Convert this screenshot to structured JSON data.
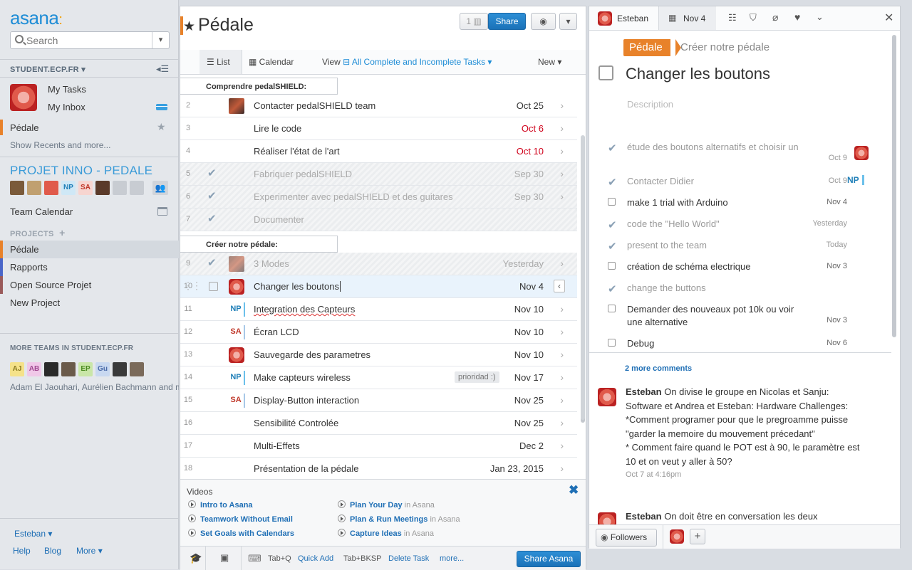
{
  "sidebar": {
    "logo": "asana",
    "search_placeholder": "Search",
    "workspace": "STUDENT.ECP.FR",
    "my_tasks": "My Tasks",
    "my_inbox": "My Inbox",
    "favorite": "Pédale",
    "show_recents": "Show Recents and more...",
    "team_name": "PROJET INNO - PEDALE",
    "team_members": [
      {
        "initials": "",
        "color": "#7a5a3a"
      },
      {
        "initials": "",
        "color": "#c0a070"
      },
      {
        "initials": "",
        "color": "#e05a4b"
      },
      {
        "initials": "NP",
        "color": "#cfe8f6",
        "text": "#1f7fb8"
      },
      {
        "initials": "SA",
        "color": "#f7d5d0",
        "text": "#c0392b"
      },
      {
        "initials": "",
        "color": "#5a3a2a"
      },
      {
        "initials": "",
        "color": "#c8ccd2"
      },
      {
        "initials": "",
        "color": "#c8ccd2"
      }
    ],
    "team_calendar": "Team Calendar",
    "projects_header": "PROJECTS",
    "projects": [
      {
        "name": "Pédale",
        "color": "#e8822a"
      },
      {
        "name": "Rapports",
        "color": "#4a66c9"
      },
      {
        "name": "Open Source Projet",
        "color": "#9a5a5a"
      },
      {
        "name": "New Project",
        "color": ""
      }
    ],
    "more_teams_header": "MORE TEAMS IN STUDENT.ECP.FR",
    "more_team_members": [
      {
        "initials": "AJ",
        "color": "#f5e28a",
        "text": "#8a7a20"
      },
      {
        "initials": "AB",
        "color": "#f0c8e8",
        "text": "#a04890"
      },
      {
        "initials": "",
        "color": "#2a2a2a"
      },
      {
        "initials": "",
        "color": "#6a5a4a"
      },
      {
        "initials": "EP",
        "color": "#c9e6a8",
        "text": "#4a8a20"
      },
      {
        "initials": "Gu",
        "color": "#c8d8f0",
        "text": "#4a6aa8"
      },
      {
        "initials": "",
        "color": "#3a3a3a"
      },
      {
        "initials": "",
        "color": "#7a6a5a"
      }
    ],
    "more_teams_names": "Adam El Jaouhari, Aurélien Bachmann and m",
    "user": "Esteban",
    "help": "Help",
    "blog": "Blog",
    "more": "More"
  },
  "project": {
    "title": "Pédale",
    "member_count": "1",
    "share": "Share",
    "tab_list": "List",
    "tab_calendar": "Calendar",
    "view_label": "View",
    "view_value": "All Complete and Incomplete Tasks",
    "new_label": "New"
  },
  "sections": [
    {
      "title": "Comprendre pedalSHIELD:"
    },
    {
      "title": "Créer notre pédale:"
    }
  ],
  "tasks": [
    {
      "num": "2",
      "name": "Contacter pedalSHIELD team",
      "due": "Oct 25",
      "assignee": "photo",
      "done": false
    },
    {
      "num": "3",
      "name": "Lire le code",
      "due": "Oct 6",
      "overdue": true,
      "done": false
    },
    {
      "num": "4",
      "name": "Réaliser l'état de l'art",
      "due": "Oct 10",
      "overdue": true,
      "done": false
    },
    {
      "num": "5",
      "name": "Fabriquer pedalSHIELD",
      "due": "Sep 30",
      "done": true
    },
    {
      "num": "6",
      "name": "Experimenter avec pedalSHIELD et des guitares",
      "due": "Sep 30",
      "done": true
    },
    {
      "num": "7",
      "name": "Documenter",
      "due": "",
      "done": true
    },
    {
      "num": "9",
      "name": "3 Modes",
      "due": "Yesterday",
      "assignee": "photo",
      "done": true
    },
    {
      "num": "10",
      "name": "Changer les boutons",
      "due": "Nov 4",
      "assignee": "pedal",
      "done": false,
      "selected": true
    },
    {
      "num": "11",
      "name": "Integration des Capteurs",
      "due": "Nov 10",
      "assignee": "NP",
      "done": false
    },
    {
      "num": "12",
      "name": "Écran LCD",
      "due": "Nov 10",
      "assignee": "SA",
      "done": false
    },
    {
      "num": "13",
      "name": "Sauvegarde des parametres",
      "due": "Nov 10",
      "assignee": "pedal",
      "done": false
    },
    {
      "num": "14",
      "name": "Make capteurs wireless",
      "due": "Nov 17",
      "assignee": "NP",
      "tag": "prioridad :)",
      "done": false
    },
    {
      "num": "15",
      "name": "Display-Button interaction",
      "due": "Nov 25",
      "assignee": "SA",
      "done": false
    },
    {
      "num": "16",
      "name": "Sensibilité Controlée",
      "due": "Nov 25",
      "done": false
    },
    {
      "num": "17",
      "name": "Multi-Effets",
      "due": "Dec 2",
      "done": false
    },
    {
      "num": "18",
      "name": "Présentation de la pédale",
      "due": "Jan 23, 2015",
      "done": false
    }
  ],
  "videos": {
    "title": "Videos",
    "in_label": "in Asana",
    "links": [
      "Intro to Asana",
      "Teamwork Without Email",
      "Set Goals with Calendars",
      "Plan Your Day",
      "Plan & Run Meetings",
      "Capture Ideas"
    ]
  },
  "shortcuts": {
    "quick_add_key": "Tab+Q",
    "quick_add": "Quick Add",
    "delete_key": "Tab+BKSP",
    "delete": "Delete Task",
    "more": "more...",
    "share_asana": "Share Asana"
  },
  "detail": {
    "assignee": "Esteban",
    "due": "Nov 4",
    "project_tag": "Pédale",
    "section": "Créer notre pédale",
    "title": "Changer les boutons",
    "description_placeholder": "Description",
    "subtasks": [
      {
        "text": "étude des boutons alternatifs et choisir un",
        "date": "Oct 9",
        "done": true,
        "assignee": "pedal"
      },
      {
        "text": "Contacter Didier",
        "date": "Oct 9",
        "done": true,
        "assignee": "NP"
      },
      {
        "text": "make 1 trial with Arduino",
        "date": "Nov 4",
        "done": false
      },
      {
        "text": "code the \"Hello World\"",
        "date": "Yesterday",
        "done": true
      },
      {
        "text": "present to the team",
        "date": "Today",
        "done": true
      },
      {
        "text": "création de schéma electrique",
        "date": "Nov 3",
        "done": false
      },
      {
        "text": "change the buttons",
        "date": "",
        "done": true
      },
      {
        "text": "Demander des nouveaux pot 10k ou voir une alternative",
        "date": "Nov 3",
        "done": false
      },
      {
        "text": "Debug",
        "date": "Nov 6",
        "done": false
      }
    ],
    "more_comments": "2 more comments",
    "comments": [
      {
        "author": "Esteban",
        "text": "On divise le groupe en Nicolas et Sanju: Software et Andrea et Esteban: Hardware Challenges: *Comment programer pour que le pregroamme puisse \"garder la memoire du mouvement précedant\"",
        "text2": "* Comment faire quand le POT est à 90, le paramètre est  10 et on veut y aller à 50?",
        "time": "Oct 7 at 4:16pm"
      },
      {
        "author": "Esteban",
        "text": "On doit être en conversation les deux",
        "text2": "",
        "time": ""
      }
    ],
    "followers": "Followers"
  },
  "colors": {
    "accent": "#1f8dd6",
    "project": "#e8822a",
    "overdue": "#d0021b",
    "np": "#1f7fb8",
    "sa": "#c0392b"
  }
}
